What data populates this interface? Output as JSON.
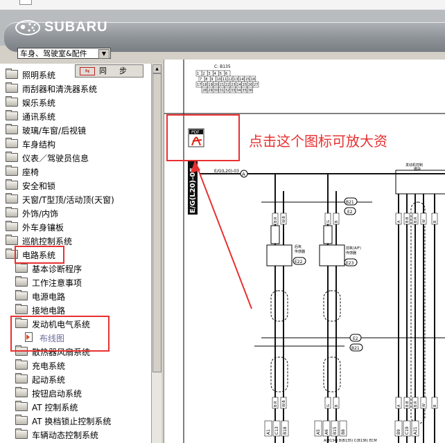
{
  "header": {
    "brand": "SUBARU",
    "logo_icon": "subaru-stars-icon"
  },
  "section_selector": {
    "value": "车身、驾驶室&配件"
  },
  "sync_button": {
    "label": "同步"
  },
  "tree": [
    {
      "label": "照明系统",
      "type": "folder"
    },
    {
      "label": "雨刮器和清洗器系统",
      "type": "folder"
    },
    {
      "label": "娱乐系统",
      "type": "folder"
    },
    {
      "label": "通讯系统",
      "type": "folder"
    },
    {
      "label": "玻璃/车窗/后视镜",
      "type": "folder"
    },
    {
      "label": "车身结构",
      "type": "folder"
    },
    {
      "label": "仪表／驾驶员信息",
      "type": "folder"
    },
    {
      "label": "座椅",
      "type": "folder"
    },
    {
      "label": "安全和锁",
      "type": "folder"
    },
    {
      "label": "天窗/T型顶/活动顶(天窗)",
      "type": "folder"
    },
    {
      "label": "外饰/内饰",
      "type": "folder"
    },
    {
      "label": "外车身镶板",
      "type": "folder"
    },
    {
      "label": "巡航控制系统",
      "type": "folder"
    },
    {
      "label": "电路系统",
      "type": "folder",
      "expanded": true
    },
    {
      "label": "基本诊断程序",
      "type": "folder",
      "level": 1
    },
    {
      "label": "工作注意事项",
      "type": "folder",
      "level": 1
    },
    {
      "label": "电源电路",
      "type": "folder",
      "level": 1
    },
    {
      "label": "接地电路",
      "type": "folder",
      "level": 1
    },
    {
      "label": "发动机电气系统",
      "type": "folder",
      "level": 1,
      "expanded": true
    },
    {
      "label": "布线图",
      "type": "document",
      "level": 2,
      "selected": true
    },
    {
      "label": "散热器风扇系统",
      "type": "folder",
      "level": 1
    },
    {
      "label": "充电系统",
      "type": "folder",
      "level": 1
    },
    {
      "label": "起动系统",
      "type": "folder",
      "level": 1
    },
    {
      "label": "按钮启动系统",
      "type": "folder",
      "level": 1
    },
    {
      "label": "AT 控制系统",
      "type": "folder",
      "level": 1
    },
    {
      "label": "AT 换档锁止控制系统",
      "type": "folder",
      "level": 1
    },
    {
      "label": "车辆动态控制系统",
      "type": "folder",
      "level": 1
    }
  ],
  "diagram": {
    "page_code": "E/G(L20)-05",
    "connector_id": "C: B135",
    "connector_pins": [
      [
        "1",
        "2",
        "3",
        "4",
        "5",
        "6"
      ],
      [
        "7",
        "8",
        "9",
        "10",
        "11",
        "12",
        "13",
        "14",
        "15",
        "16"
      ],
      [
        "17",
        "18",
        "19",
        "20",
        "21",
        "22",
        "23",
        "24",
        "25",
        "26",
        "27"
      ],
      [
        "28",
        "29",
        "30",
        "31",
        "32",
        "33",
        "34",
        "35",
        "36"
      ]
    ],
    "ref_label": "E/G(L20)-03",
    "ref_letter": "A",
    "pdf_icon_label": "PDF",
    "annotation": "点击这个图标可放大资",
    "right_caption_1": "发动机控制",
    "right_caption_2": "模块",
    "sensor1_label_1": "后氧",
    "sensor1_label_2": "传感器",
    "sensor1_id": "E22",
    "sensor2_label_1": "前氧(A/F)",
    "sensor2_label_2": "传感器",
    "sensor2_id": "E23",
    "conn_b21": "B21",
    "conn_e2": "E2",
    "wire_labels": [
      "B:R",
      "W:B",
      "G",
      "B",
      "A",
      "B:B",
      "B:R",
      "W",
      "B"
    ],
    "bottom_labels": [
      "A1",
      "C13",
      "B18",
      "A5",
      "A6",
      "B15",
      "B8",
      "B9",
      "C19",
      "A21"
    ],
    "footer_text": "A(B134) B(B135) C(B136) ECM"
  },
  "colors": {
    "annotation_red": "#e83030",
    "wire_black": "#111111",
    "banner_gray": "#8c9196"
  }
}
